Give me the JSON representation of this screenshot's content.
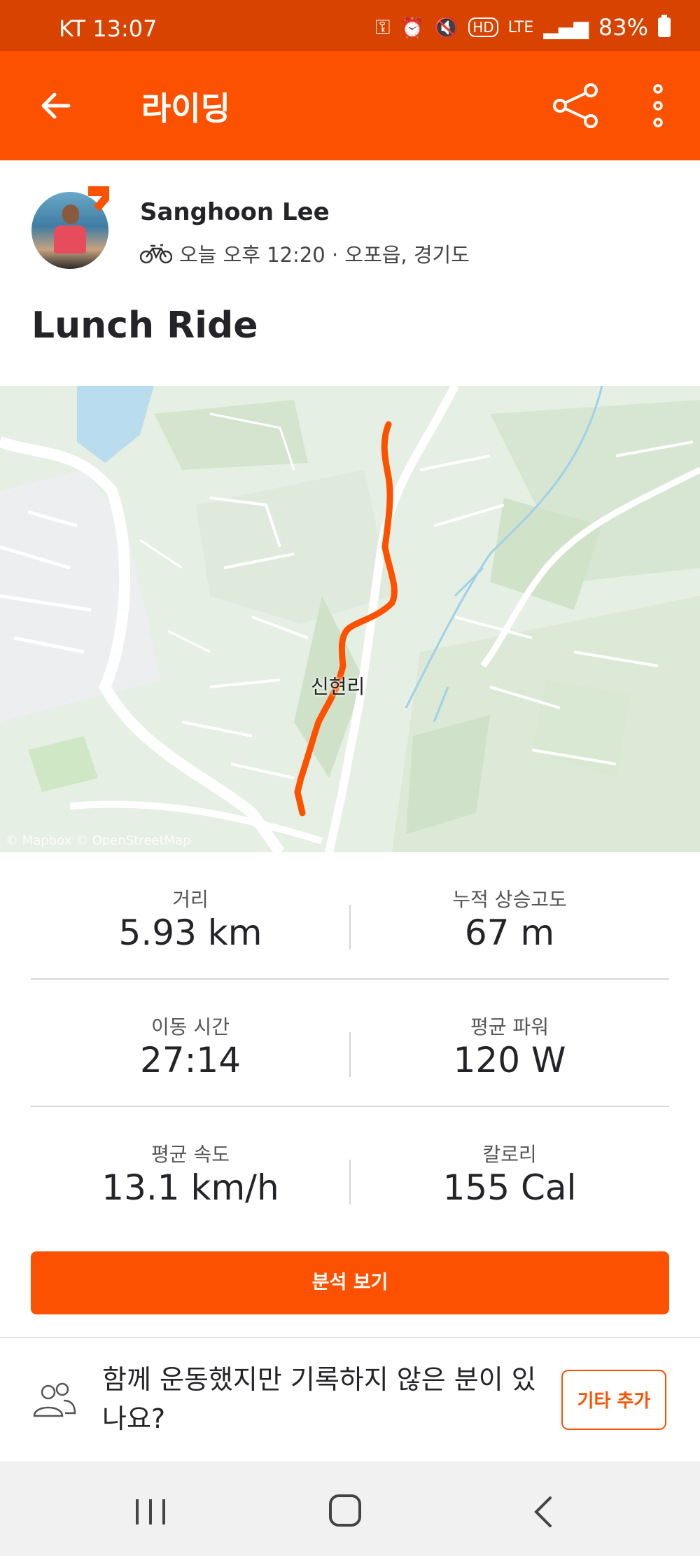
{
  "status_bar": {
    "carrier_time": "KT 13:07",
    "lte": "LTE",
    "battery": "83%"
  },
  "app_bar": {
    "title": "라이딩"
  },
  "activity": {
    "athlete_name": "Sanghoon Lee",
    "meta": "오늘 오후 12:20 · 오포읍, 경기도",
    "title": "Lunch Ride"
  },
  "map": {
    "place_label": "신현리",
    "attribution": "© Mapbox © OpenStreetMap"
  },
  "stats": [
    {
      "left_label": "거리",
      "left_value": "5.93 km",
      "right_label": "누적 상승고도",
      "right_value": "67 m"
    },
    {
      "left_label": "이동 시간",
      "left_value": "27:14",
      "right_label": "평균 파워",
      "right_value": "120 W"
    },
    {
      "left_label": "평균 속도",
      "left_value": "13.1 km/h",
      "right_label": "칼로리",
      "right_value": "155 Cal"
    }
  ],
  "actions": {
    "analysis_button": "분석 보기",
    "group_prompt": "함께 운동했지만 기록하지 않은 분이 있나요?",
    "add_other_button": "기타 추가"
  },
  "colors": {
    "brand": "#fc5200",
    "status_bar": "#d84300"
  }
}
